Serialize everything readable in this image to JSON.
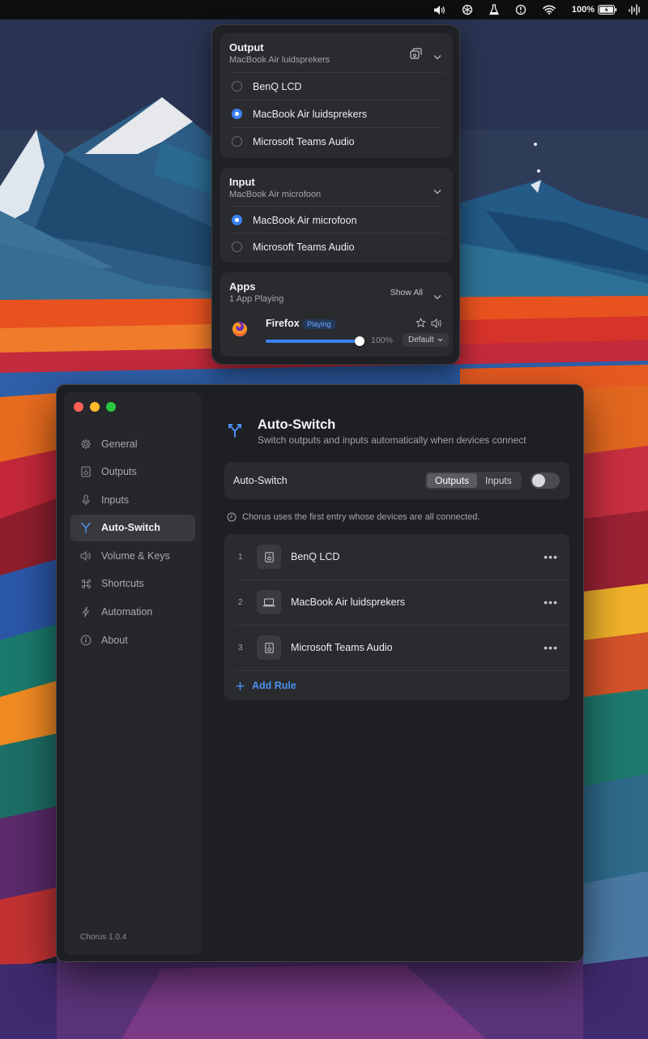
{
  "menubar": {
    "battery_label": "100%",
    "icons": [
      "volume-icon",
      "chatgpt-icon",
      "flask-icon",
      "clock-alert-icon",
      "wifi-icon",
      "battery-icon",
      "waveform-icon"
    ]
  },
  "popover": {
    "output": {
      "title": "Output",
      "subtitle": "MacBook Air luidsprekers",
      "devices": [
        {
          "label": "BenQ LCD",
          "selected": false
        },
        {
          "label": "MacBook Air luidsprekers",
          "selected": true
        },
        {
          "label": "Microsoft Teams Audio",
          "selected": false
        }
      ]
    },
    "input": {
      "title": "Input",
      "subtitle": "MacBook Air microfoon",
      "devices": [
        {
          "label": "MacBook Air microfoon",
          "selected": true
        },
        {
          "label": "Microsoft Teams Audio",
          "selected": false
        }
      ]
    },
    "apps": {
      "title": "Apps",
      "subtitle": "1 App Playing",
      "show_all": "Show All",
      "items": [
        {
          "name": "Firefox",
          "status": "Playing",
          "volume_percent": 100,
          "volume_label": "100%",
          "device": "Default"
        }
      ]
    }
  },
  "window": {
    "sidebar": {
      "items": [
        {
          "label": "General",
          "icon": "gear-icon",
          "active": false
        },
        {
          "label": "Outputs",
          "icon": "speaker-icon",
          "active": false
        },
        {
          "label": "Inputs",
          "icon": "microphone-icon",
          "active": false
        },
        {
          "label": "Auto-Switch",
          "icon": "branch-icon",
          "active": true
        },
        {
          "label": "Volume & Keys",
          "icon": "volume-icon",
          "active": false
        },
        {
          "label": "Shortcuts",
          "icon": "command-icon",
          "active": false
        },
        {
          "label": "Automation",
          "icon": "bolt-icon",
          "active": false
        },
        {
          "label": "About",
          "icon": "info-icon",
          "active": false
        }
      ],
      "version": "Chorus 1.0.4"
    },
    "main": {
      "title": "Auto-Switch",
      "subtitle": "Switch outputs and inputs automatically when devices connect",
      "autoswitch_label": "Auto-Switch",
      "segments": [
        {
          "label": "Outputs",
          "selected": true
        },
        {
          "label": "Inputs",
          "selected": false
        }
      ],
      "toggle_on": false,
      "hint": "Chorus uses the first entry whose devices are all connected.",
      "rules": [
        {
          "index": "1",
          "label": "BenQ LCD",
          "icon": "speaker-icon"
        },
        {
          "index": "2",
          "label": "MacBook Air luidsprekers",
          "icon": "laptop-icon"
        },
        {
          "index": "3",
          "label": "Microsoft Teams Audio",
          "icon": "speaker-icon"
        }
      ],
      "add_rule": "Add Rule"
    }
  },
  "colors": {
    "accent": "#3b82f6",
    "accent_text": "#4a90f2",
    "traffic_red": "#ff5f57",
    "traffic_yellow": "#febc2e",
    "traffic_green": "#28c840"
  }
}
